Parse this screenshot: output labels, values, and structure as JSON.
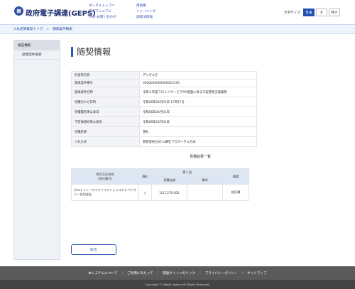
{
  "header": {
    "logo_text": "調",
    "title": "政府電子調達(GEPS)",
    "nav_col1": [
      "ポータルトップへ",
      "操作マニュアル",
      "FAQ･お問い合わせ"
    ],
    "nav_col2": [
      "用語集",
      "トレーニング",
      "調達法情報"
    ],
    "font_size_label": "文字サイズ",
    "font_sizes": [
      "普通",
      "大",
      "特大"
    ]
  },
  "breadcrumb": {
    "items": [
      "入札結果確認トップ",
      "調達案件検索"
    ],
    "separator": ">"
  },
  "sidebar": {
    "title": "検証機能",
    "items": [
      "調達案件検索"
    ]
  },
  "main": {
    "page_title": "随契情報",
    "details": [
      {
        "label": "府省等名称",
        "value": "デジタル庁"
      },
      {
        "label": "調達案件番号",
        "value": "0000000000000423195"
      },
      {
        "label": "調達案件名称",
        "value": "令和６年度フロントサービスAPI基盤に係る工程管理支援業務"
      },
      {
        "label": "見積合わせ日時",
        "value": "令和06年04月01日 17時17分"
      },
      {
        "label": "見積書結果公表日",
        "value": "令和06年04月01日"
      },
      {
        "label": "予定価格結果公表日",
        "value": "令和06年04月01日"
      },
      {
        "label": "見積結果",
        "value": "落札"
      },
      {
        "label": "入札方式",
        "value": "随意契約方式-公募型プロポーザル方式"
      }
    ],
    "results_title": "見積結果一覧",
    "results": {
      "headers": {
        "name": "商号又は名称\n(見付番号)",
        "award": "落札",
        "round": "第１回",
        "amount": "見積金額",
        "remarks": "備考",
        "note": "摘要"
      },
      "rows": [
        {
          "name": "デロイトトーマツファイナンシャルアドバイザリー合同会社",
          "award": "○",
          "amount": "\\127,270,000",
          "remarks": "",
          "note": "総見積"
        }
      ]
    },
    "back_button": "戻る"
  },
  "footer": {
    "links": [
      "本システムについて",
      "ご利用にあたって",
      "関連サイトへのリンク",
      "プライバシーポリシー",
      "サイトマップ"
    ],
    "divider": "|",
    "copyright": "Copyright © Digital Agency All Rights Reserved."
  },
  "colors": {
    "accent": "#2b58b7",
    "footer_bg": "#5a5a5a",
    "table_header_bg": "#dde6f3"
  }
}
